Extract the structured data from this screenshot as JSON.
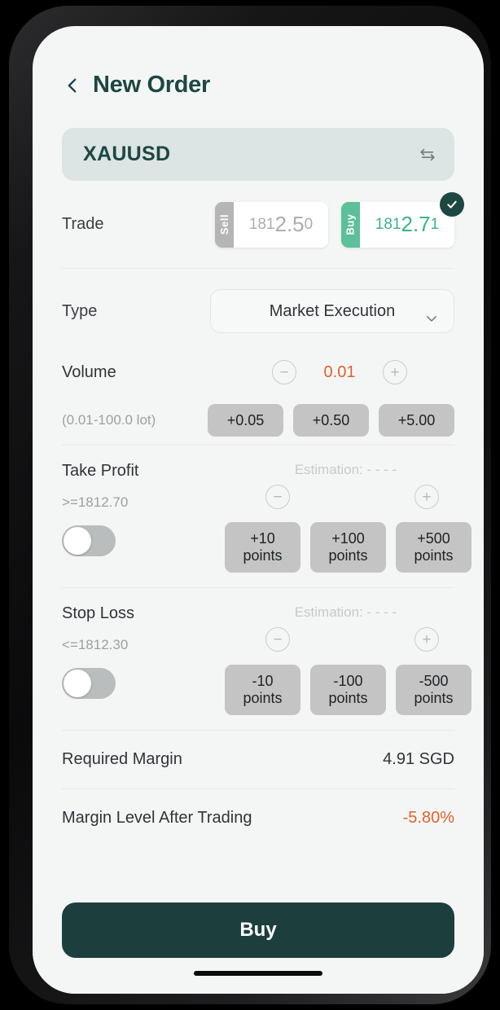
{
  "header": {
    "back_icon": "chevron-left-icon",
    "title": "New Order"
  },
  "symbol": {
    "name": "XAUUSD",
    "swap_icon": "swap-horizontal-icon"
  },
  "trade": {
    "label": "Trade",
    "selected": "buy",
    "sell": {
      "tab_label": "Sell",
      "price_prefix": "181",
      "price_main": "2.5",
      "price_suffix": "0"
    },
    "buy": {
      "tab_label": "Buy",
      "price_prefix": "181",
      "price_main": "2.7",
      "price_suffix": "1"
    },
    "check_icon": "check-icon"
  },
  "type": {
    "label": "Type",
    "value": "Market Execution",
    "chevron_icon": "chevron-down-icon"
  },
  "volume": {
    "label": "Volume",
    "hint": "(0.01-100.0 lot)",
    "value": "0.01",
    "minus": "−",
    "plus": "+",
    "quick": [
      "+0.05",
      "+0.50",
      "+5.00"
    ]
  },
  "take_profit": {
    "label": "Take Profit",
    "condition": ">=1812.70",
    "estimation": "Estimation: - - - -",
    "enabled": false,
    "minus": "−",
    "plus": "+",
    "quick": [
      {
        "amount": "+10",
        "unit": "points"
      },
      {
        "amount": "+100",
        "unit": "points"
      },
      {
        "amount": "+500",
        "unit": "points"
      }
    ]
  },
  "stop_loss": {
    "label": "Stop Loss",
    "condition": "<=1812.30",
    "estimation": "Estimation: - - - -",
    "enabled": false,
    "minus": "−",
    "plus": "+",
    "quick": [
      {
        "amount": "-10",
        "unit": "points"
      },
      {
        "amount": "-100",
        "unit": "points"
      },
      {
        "amount": "-500",
        "unit": "points"
      }
    ]
  },
  "summary": [
    {
      "label": "Required Margin",
      "value": "4.91 SGD",
      "negative": false
    },
    {
      "label": "Margin Level After Trading",
      "value": "-5.80%",
      "negative": true
    }
  ],
  "action": {
    "buy_label": "Buy"
  },
  "colors": {
    "brand_dark": "#1d4742",
    "buy_green": "#5cc09a",
    "accent_orange": "#e0622b",
    "screen_bg": "#f4f6f6"
  }
}
